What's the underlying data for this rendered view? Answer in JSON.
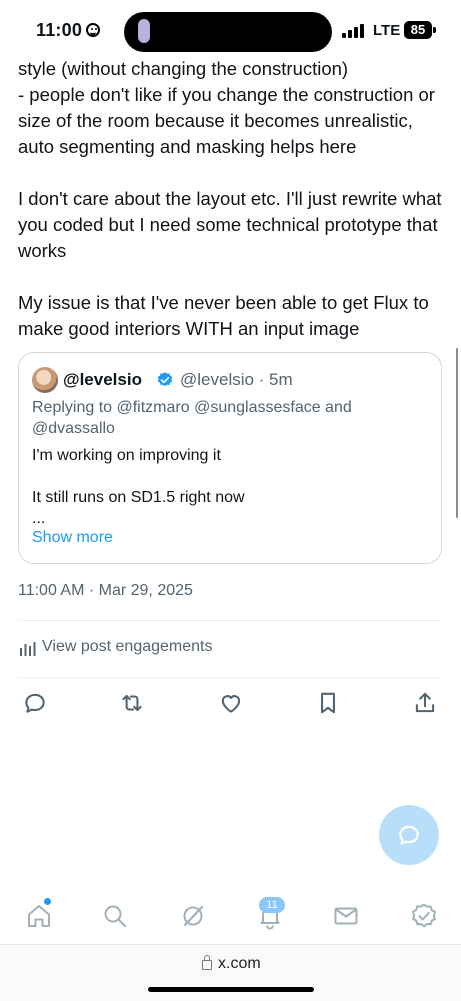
{
  "status_bar": {
    "time": "11:00",
    "network": "LTE",
    "battery": "85"
  },
  "post": {
    "text": "style (without changing the construction)\n- people don't like if you change the construction or size of the room because it becomes unrealistic, auto segmenting and masking helps here\n\nI don't care about the layout etc. I'll just rewrite what you coded but I need some technical prototype that works\n\nMy issue is that I've never been able to get Flux to make good interiors WITH an input image",
    "timestamp": "11:00 AM · Mar 29, 2025",
    "engagements_label": "View post engagements"
  },
  "quote": {
    "name": "@levelsio",
    "handle_time": "@levelsio · 5m",
    "replying": "Replying to @fitzmaro @sunglassesface and @dvassallo",
    "text": "I'm working on improving it\n\nIt still runs on SD1.5 right now\n...",
    "show_more": "Show more"
  },
  "actions": [
    "reply-icon",
    "repost-icon",
    "like-icon",
    "bookmark-icon",
    "share-icon"
  ],
  "bottom_nav": {
    "items": [
      "home-icon",
      "search-icon",
      "grok-icon",
      "notifications-icon",
      "messages-icon",
      "verified-icon"
    ],
    "notification_count": "11"
  },
  "browser": {
    "url": "x.com"
  },
  "colors": {
    "accent": "#1d9bf0",
    "text": "#0f1419",
    "muted": "#536471",
    "fab": "#b9def9"
  }
}
